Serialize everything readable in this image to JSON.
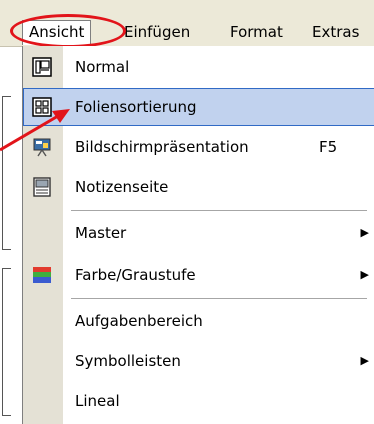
{
  "menubar": {
    "items": [
      {
        "label": "Ansicht"
      },
      {
        "label": "Einfügen"
      },
      {
        "label": "Format"
      },
      {
        "label": "Extras"
      }
    ]
  },
  "menu": {
    "items": [
      {
        "label": "Normal",
        "icon": "normal-view-icon"
      },
      {
        "label": "Foliensortierung",
        "icon": "slide-sorter-icon",
        "highlighted": true
      },
      {
        "label": "Bildschirmpräsentation",
        "shortcut": "F5",
        "icon": "slideshow-icon"
      },
      {
        "label": "Notizenseite",
        "icon": "notes-page-icon"
      },
      {
        "label": "Master",
        "submenu": true
      },
      {
        "label": "Farbe/Graustufe",
        "submenu": true,
        "icon": "color-grayscale-icon"
      },
      {
        "label": "Aufgabenbereich"
      },
      {
        "label": "Symbolleisten",
        "submenu": true
      },
      {
        "label": "Lineal"
      }
    ]
  },
  "colors": {
    "highlight_bg": "#c1d2ee",
    "highlight_border": "#316ac5",
    "annotation_red": "#e2141a",
    "menubar_bg": "#ece9d8"
  }
}
